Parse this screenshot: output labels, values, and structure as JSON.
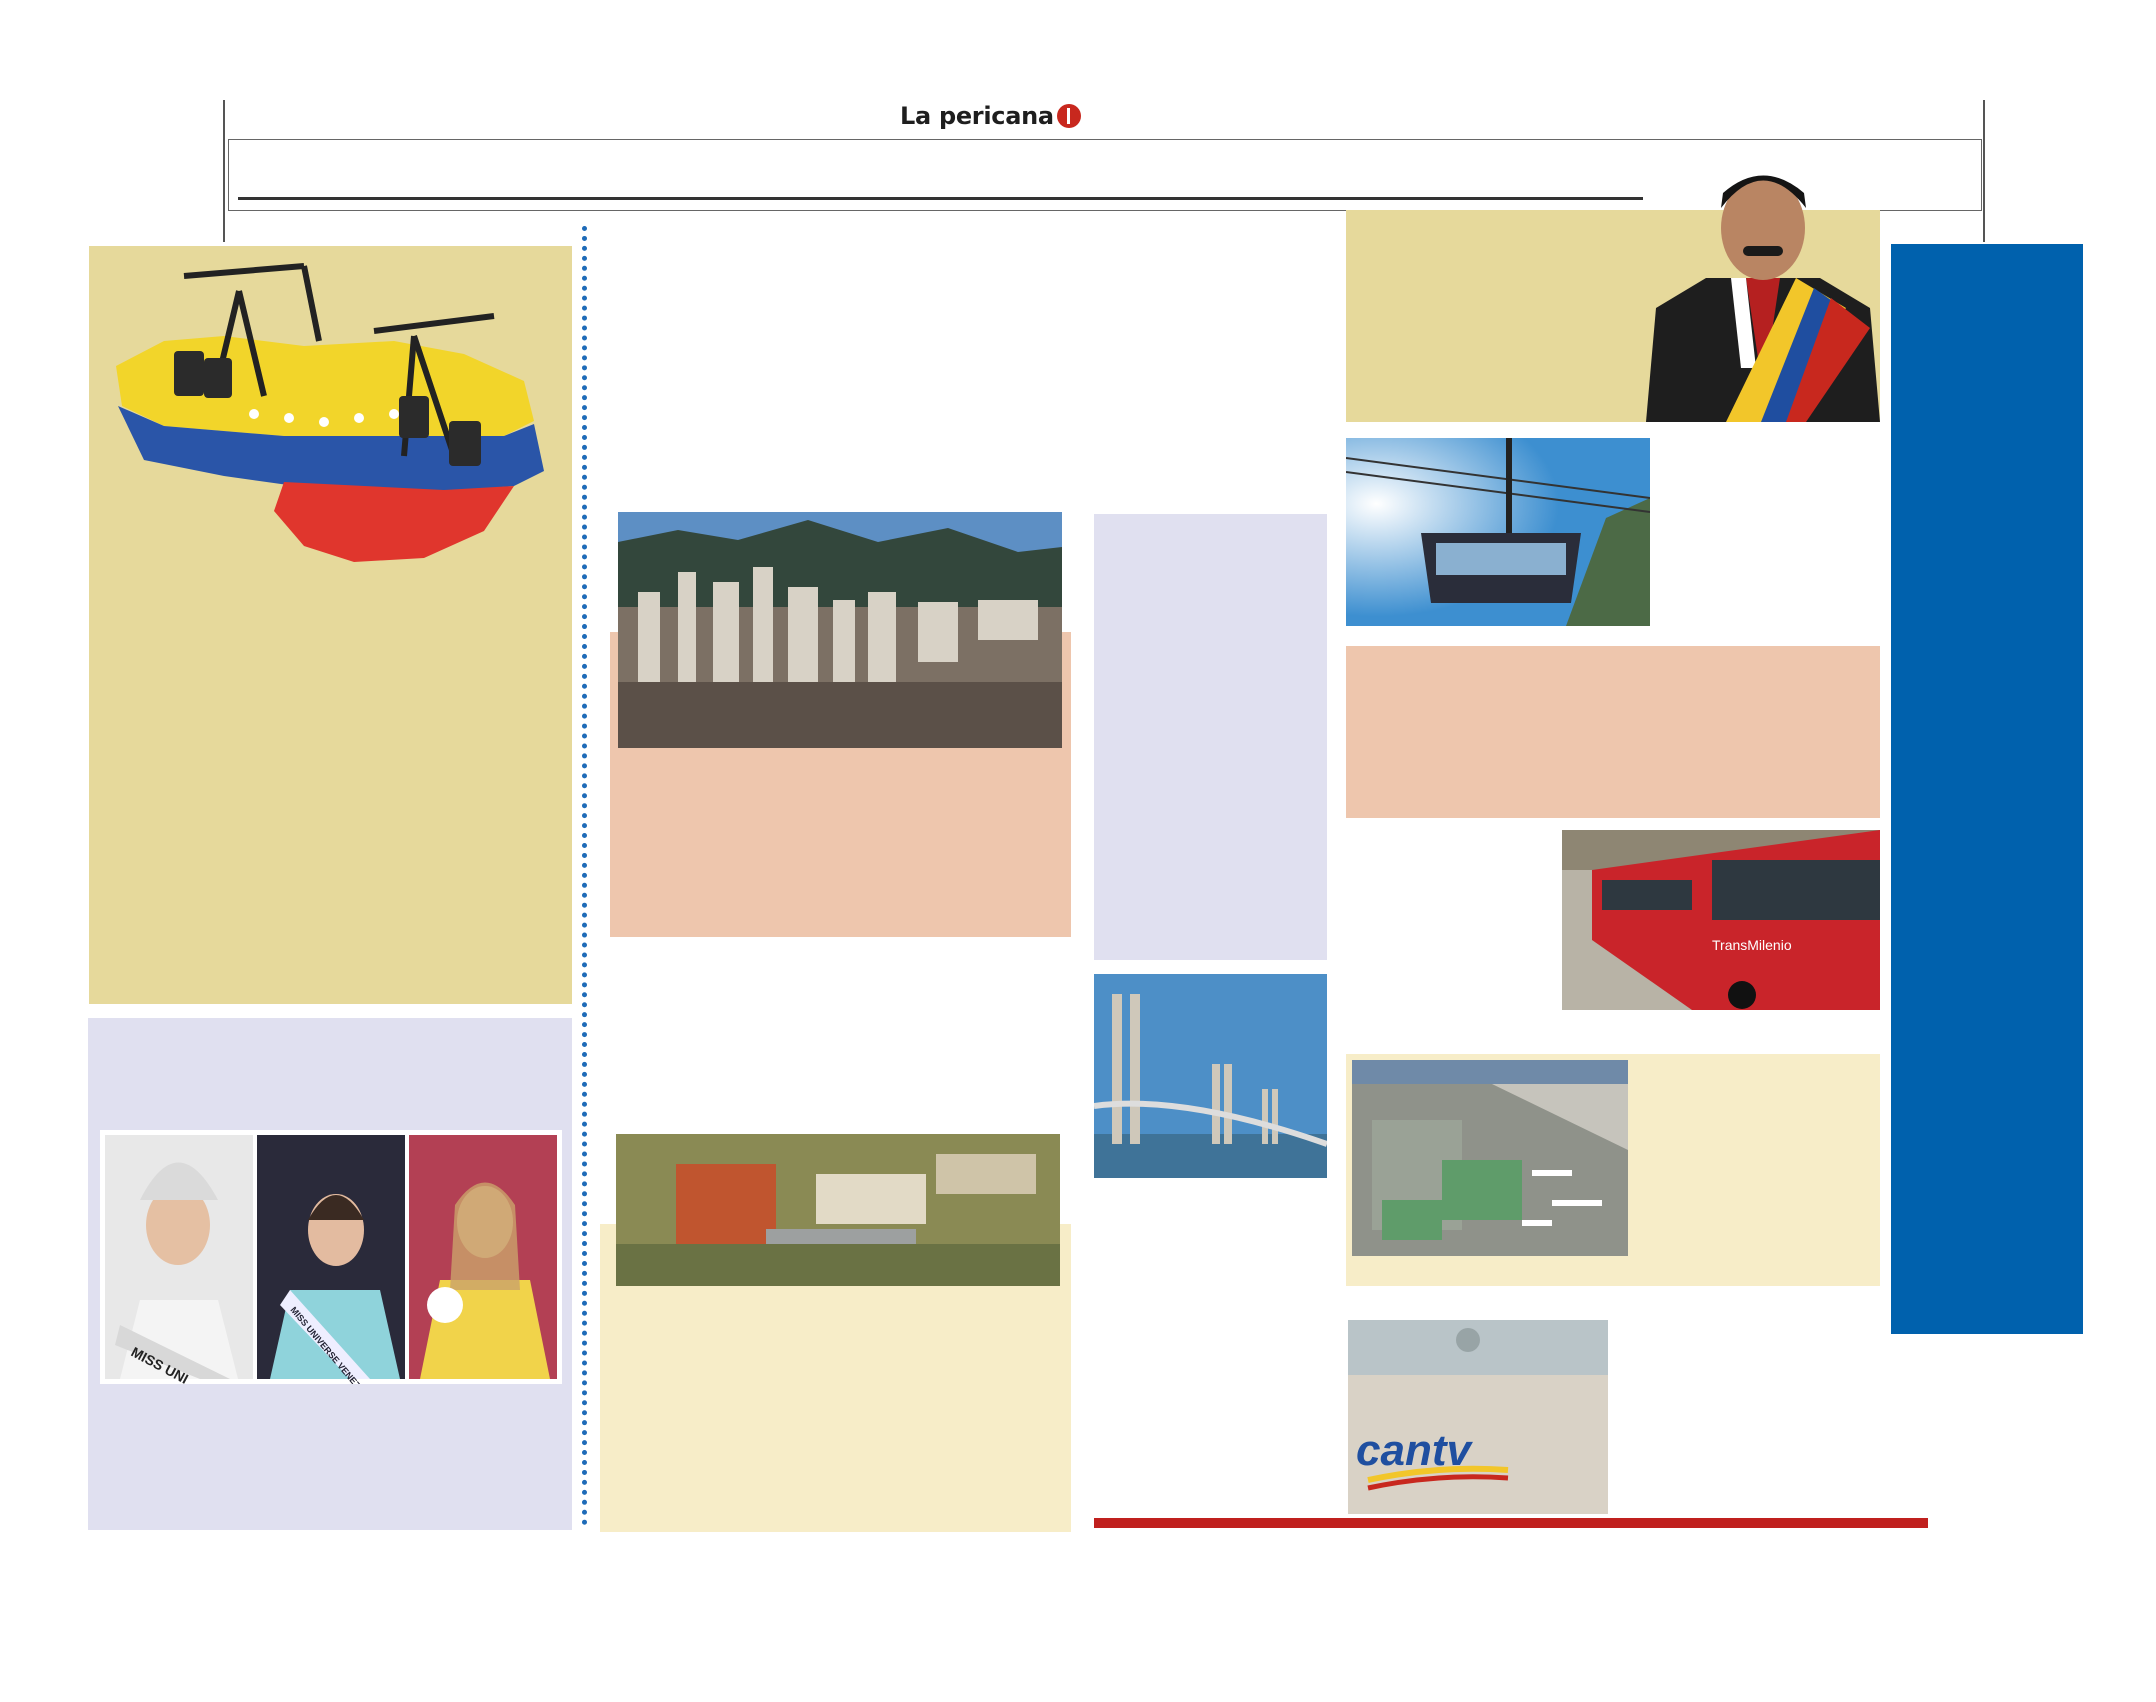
{
  "masthead": {
    "logo_text": "La pericana"
  },
  "images": {
    "oil_map": {
      "icon": "oil-map-illustration"
    },
    "caracas": {
      "icon": "city-skyline-photo"
    },
    "ucv": {
      "icon": "campus-aerial-photo"
    },
    "bridge": {
      "icon": "bridge-photo"
    },
    "president": {
      "icon": "president-portrait"
    },
    "cable_car": {
      "icon": "cable-car-photo"
    },
    "bus": {
      "icon": "bus-photo",
      "bus_text": "TransMilenio"
    },
    "airport": {
      "icon": "airport-aerial-photo"
    },
    "miss": {
      "icon": "pageant-photos",
      "sash_1": "MISS UNI",
      "sash_2": "MISS UNIVERSE VENEZUELA"
    },
    "cantv": {
      "icon": "cantv-building-photo",
      "sign_text": "cantv"
    }
  },
  "colors": {
    "yellow_panel": "#e6d99b",
    "lavender_panel": "#e0e0f0",
    "salmon_panel": "#eec6ad",
    "cream_panel": "#f7edc8",
    "blue_bar": "#0061ad",
    "red_rule": "#c0201e",
    "dots": "#1e6bb8"
  }
}
